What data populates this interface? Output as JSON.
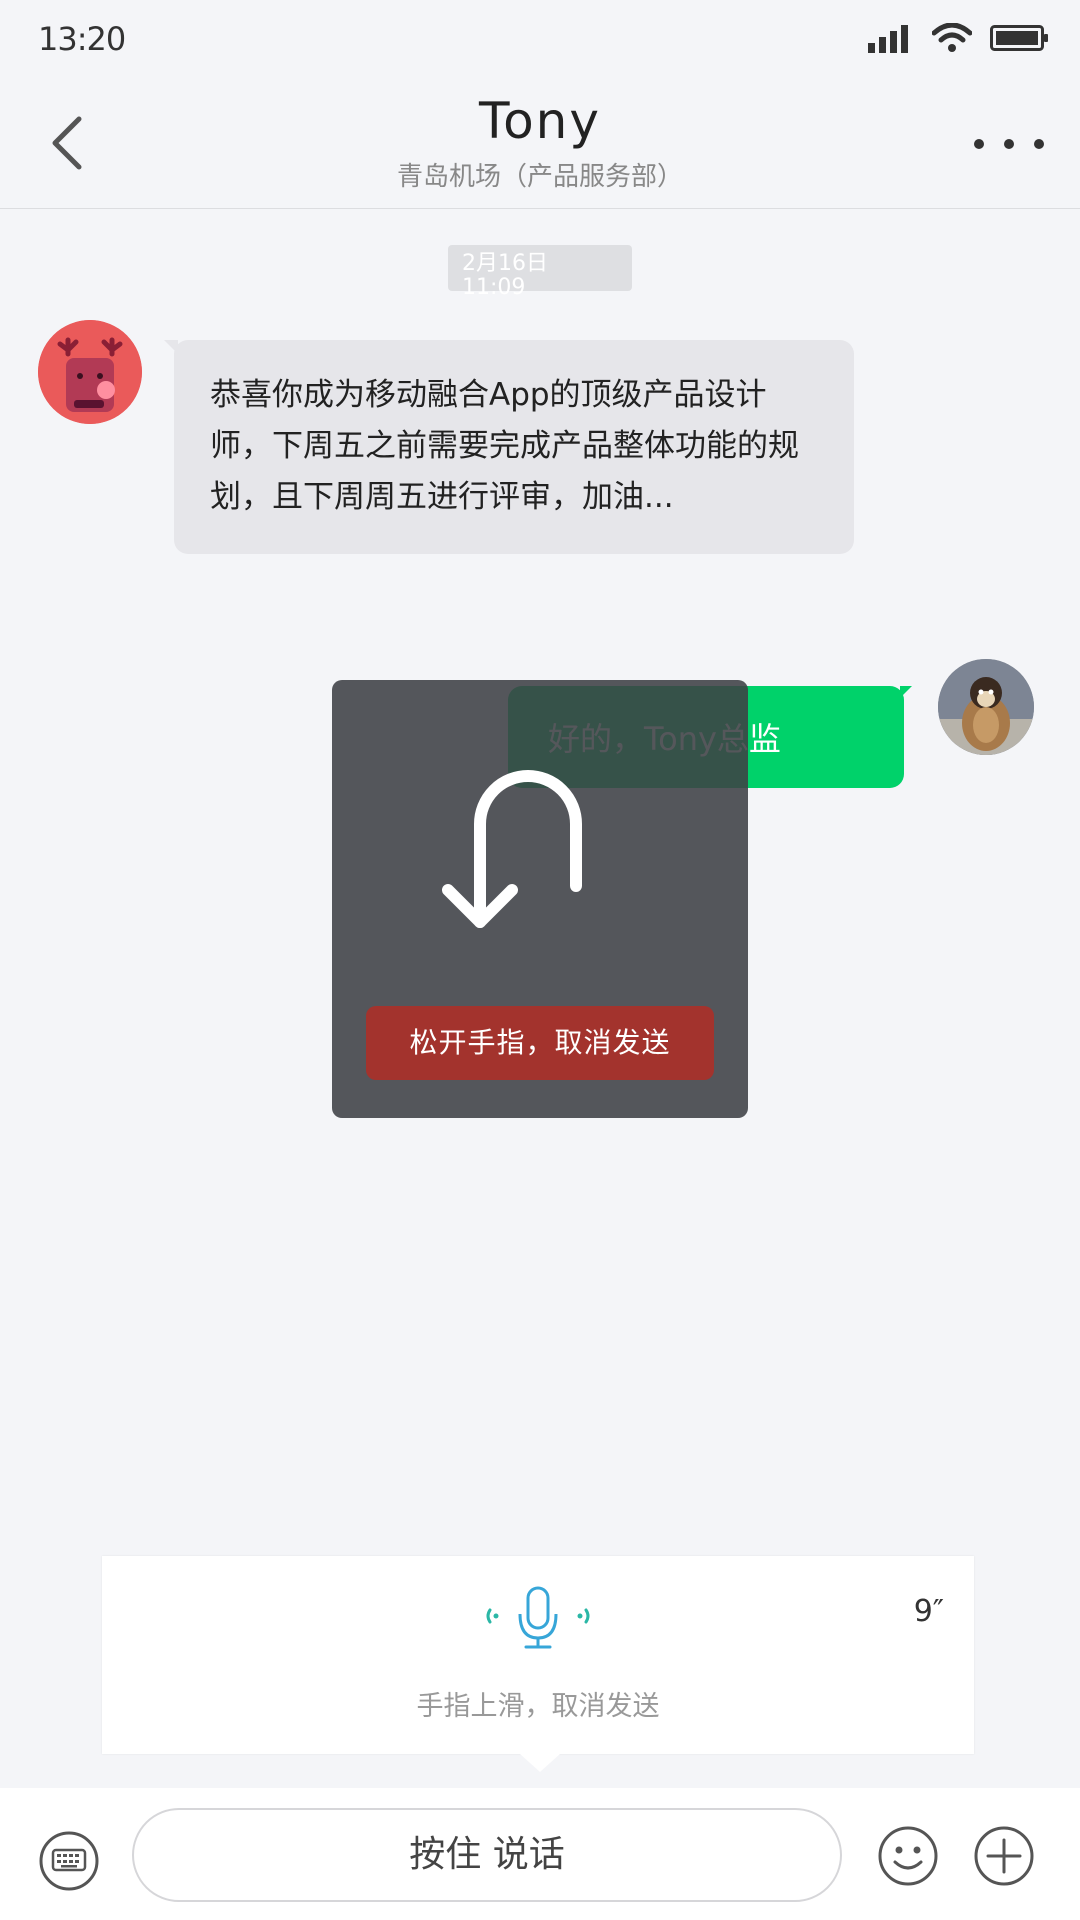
{
  "status_bar": {
    "time": "13:20",
    "icons": [
      "signal-icon",
      "wifi-icon",
      "battery-icon"
    ]
  },
  "header": {
    "title": "Tony",
    "subtitle": "青岛机场（产品服务部）",
    "back_icon": "chevron-left-icon",
    "more_icon": "more-dots-icon"
  },
  "chat": {
    "timestamp_date": "2月16日",
    "timestamp_time": "11:09",
    "messages": [
      {
        "side": "left",
        "text": "恭喜你成为移动融合App的顶级产品设计师，下周五之前需要完成产品整体功能的规划，且下周周五进行评审，加油..."
      },
      {
        "side": "right",
        "text": "好的，Tony总监"
      }
    ]
  },
  "cancel_overlay": {
    "icon": "undo-arrow-icon",
    "label": "松开手指，取消发送"
  },
  "record_panel": {
    "icon": "microphone-icon",
    "timer": "9″",
    "hint": "手指上滑，取消发送"
  },
  "input_bar": {
    "hold_to_talk": "按住 说话",
    "left_icon": "keyboard-icon",
    "emoji_icon": "smiley-icon",
    "plus_icon": "plus-icon"
  },
  "colors": {
    "background": "#f4f5f8",
    "sent_bubble": "#00d26a",
    "received_bubble": "#e6e6ea",
    "cancel_red": "#a3332d",
    "mic_accent": "#2bb7a6"
  }
}
